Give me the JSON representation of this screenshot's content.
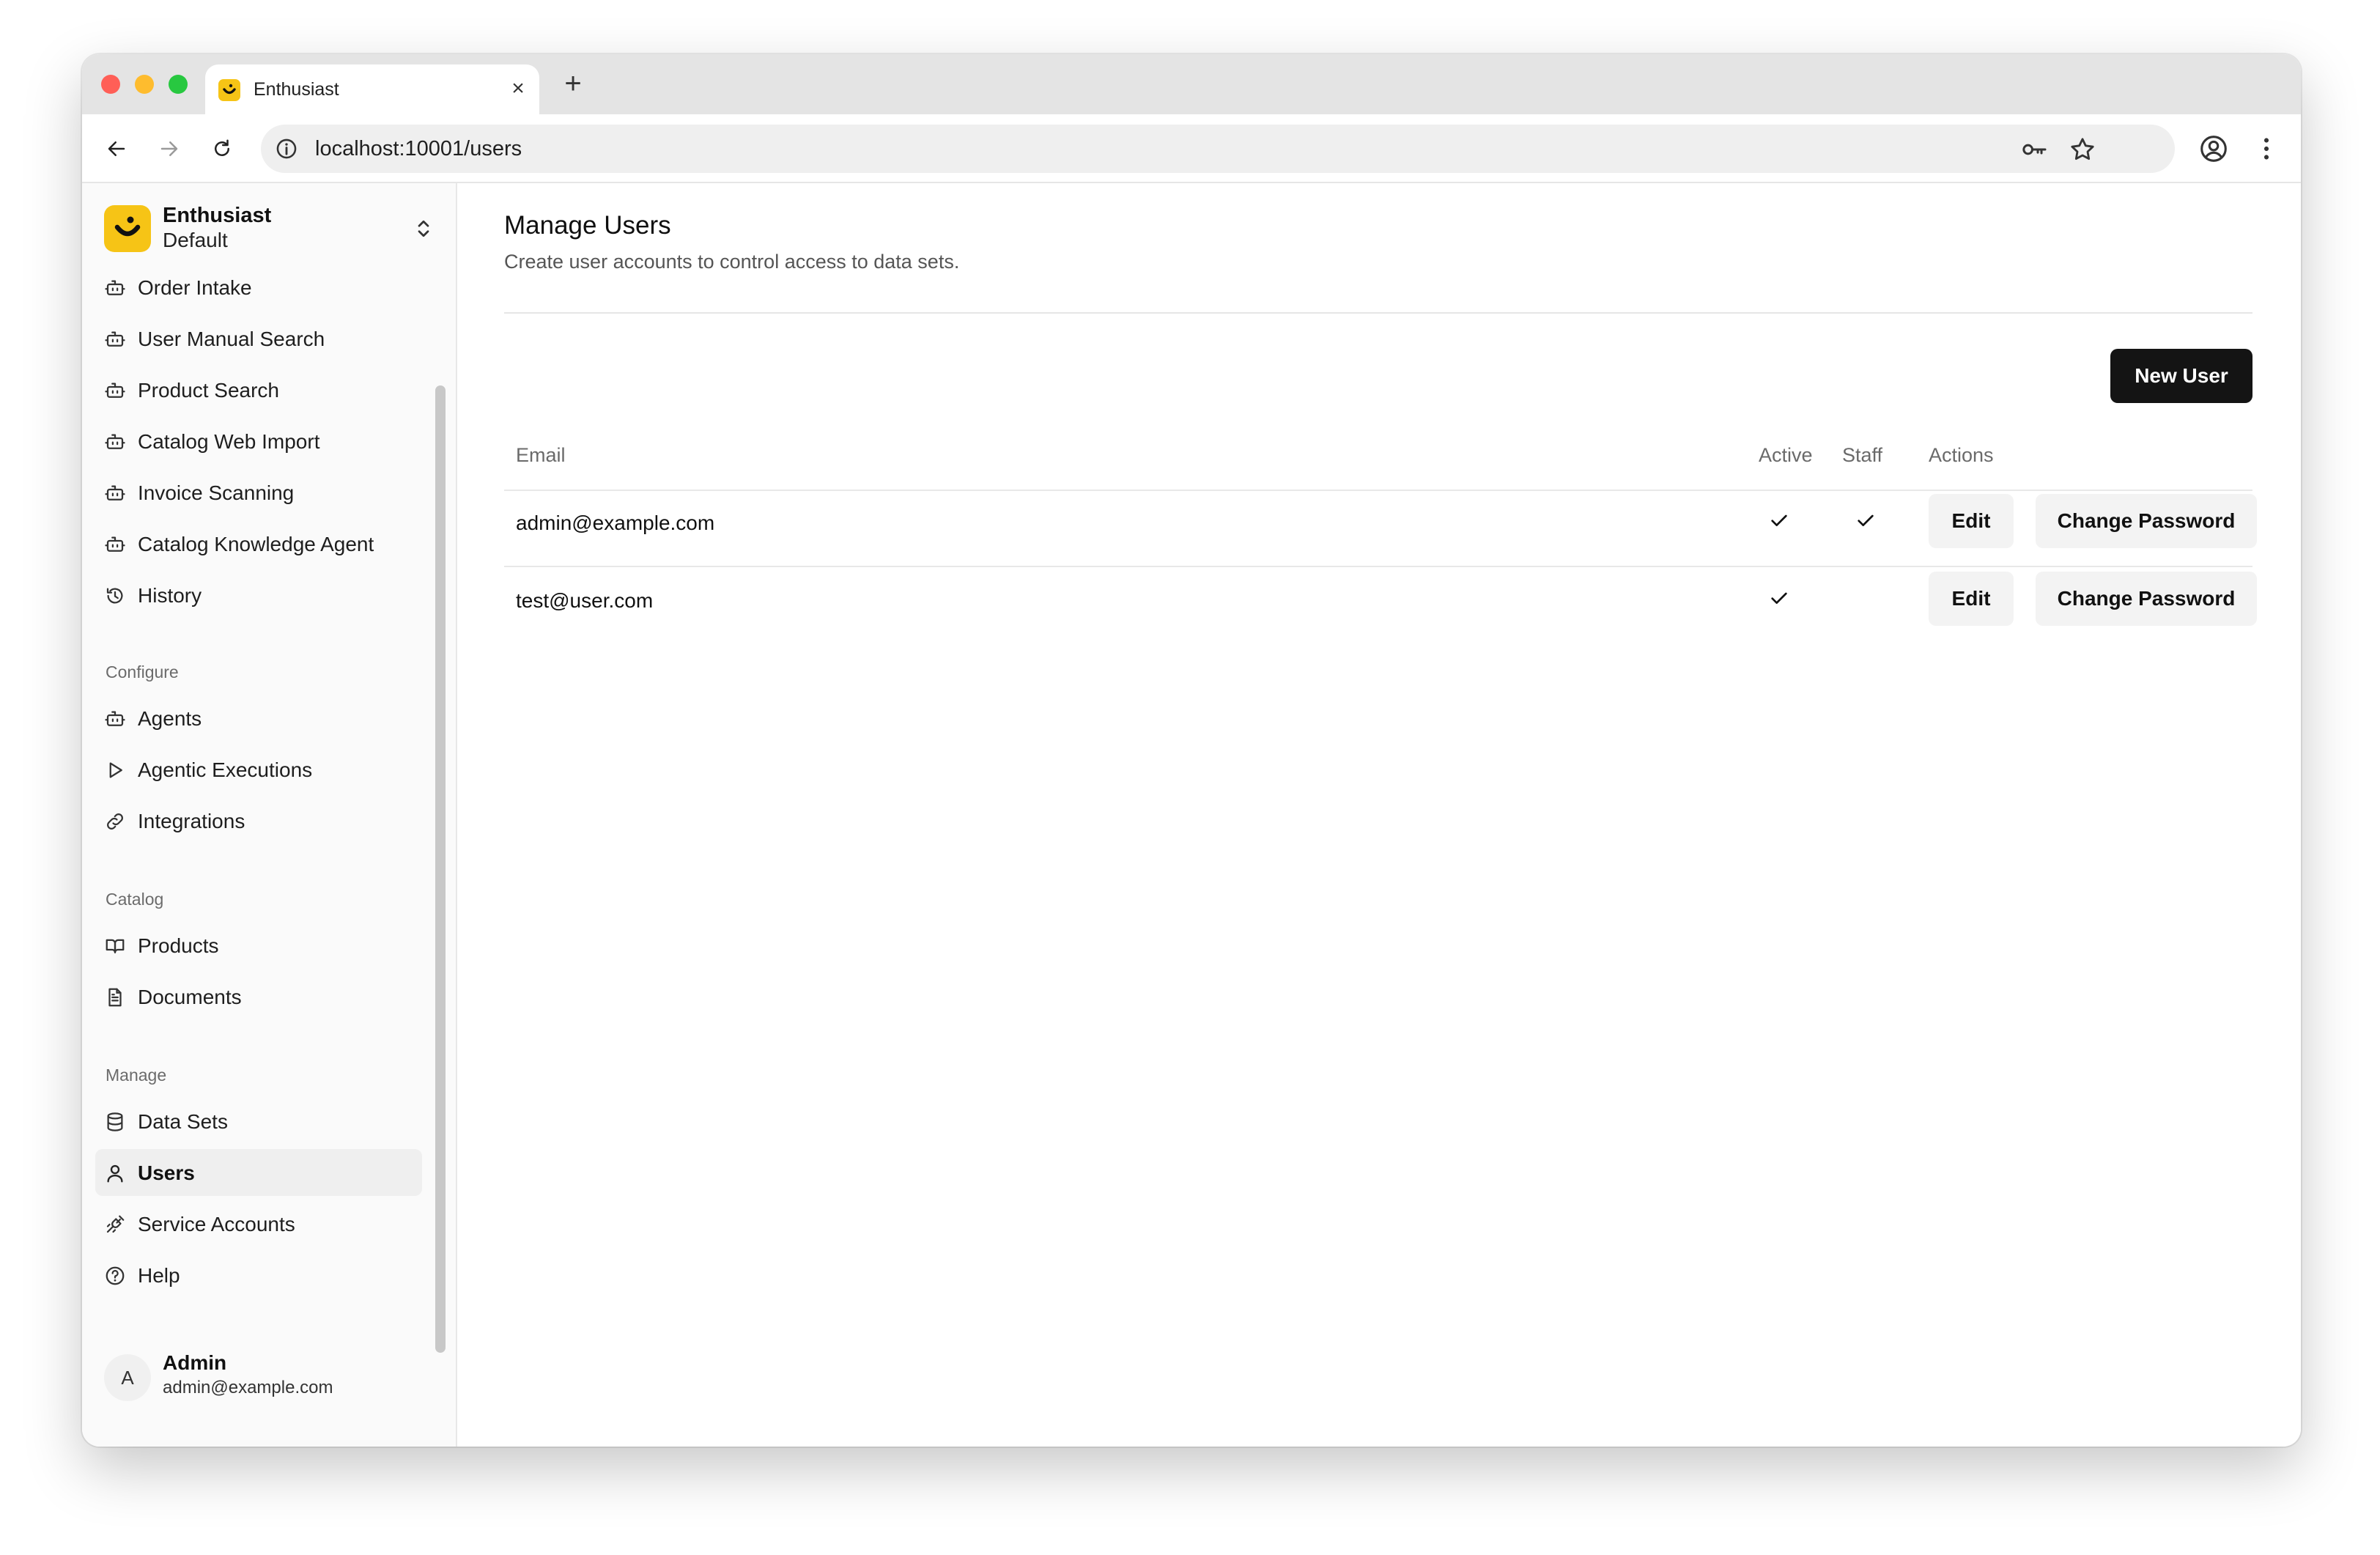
{
  "browser": {
    "tab_title": "Enthusiast",
    "url": "localhost:10001/users"
  },
  "sidebar": {
    "brand_name": "Enthusiast",
    "brand_sub": "Default",
    "top_items": [
      {
        "label": "Order Intake",
        "icon": "bot-icon"
      },
      {
        "label": "User Manual Search",
        "icon": "bot-icon"
      },
      {
        "label": "Product Search",
        "icon": "bot-icon"
      },
      {
        "label": "Catalog Web Import",
        "icon": "bot-icon"
      },
      {
        "label": "Invoice Scanning",
        "icon": "bot-icon"
      },
      {
        "label": "Catalog Knowledge Agent",
        "icon": "bot-icon"
      },
      {
        "label": "History",
        "icon": "history-icon"
      }
    ],
    "configure": {
      "label": "Configure",
      "items": [
        {
          "label": "Agents",
          "icon": "bot-icon"
        },
        {
          "label": "Agentic Executions",
          "icon": "play-icon"
        },
        {
          "label": "Integrations",
          "icon": "link-icon"
        }
      ]
    },
    "catalog": {
      "label": "Catalog",
      "items": [
        {
          "label": "Products",
          "icon": "book-icon"
        },
        {
          "label": "Documents",
          "icon": "document-icon"
        }
      ]
    },
    "manage": {
      "label": "Manage",
      "items": [
        {
          "label": "Data Sets",
          "icon": "database-icon"
        },
        {
          "label": "Users",
          "icon": "user-icon",
          "active": true
        },
        {
          "label": "Service Accounts",
          "icon": "plug-icon"
        },
        {
          "label": "Help",
          "icon": "help-icon"
        }
      ]
    },
    "user": {
      "initial": "A",
      "name": "Admin",
      "email": "admin@example.com"
    }
  },
  "main": {
    "title": "Manage Users",
    "subtitle": "Create user accounts to control access to data sets.",
    "new_user_label": "New User",
    "columns": {
      "email": "Email",
      "active": "Active",
      "staff": "Staff",
      "actions": "Actions"
    },
    "rows": [
      {
        "email": "admin@example.com",
        "active": true,
        "staff": true,
        "edit_label": "Edit",
        "change_password_label": "Change Password"
      },
      {
        "email": "test@user.com",
        "active": true,
        "staff": false,
        "edit_label": "Edit",
        "change_password_label": "Change Password"
      }
    ]
  },
  "colors": {
    "brand": "#f6c416",
    "primary_button": "#141414"
  }
}
